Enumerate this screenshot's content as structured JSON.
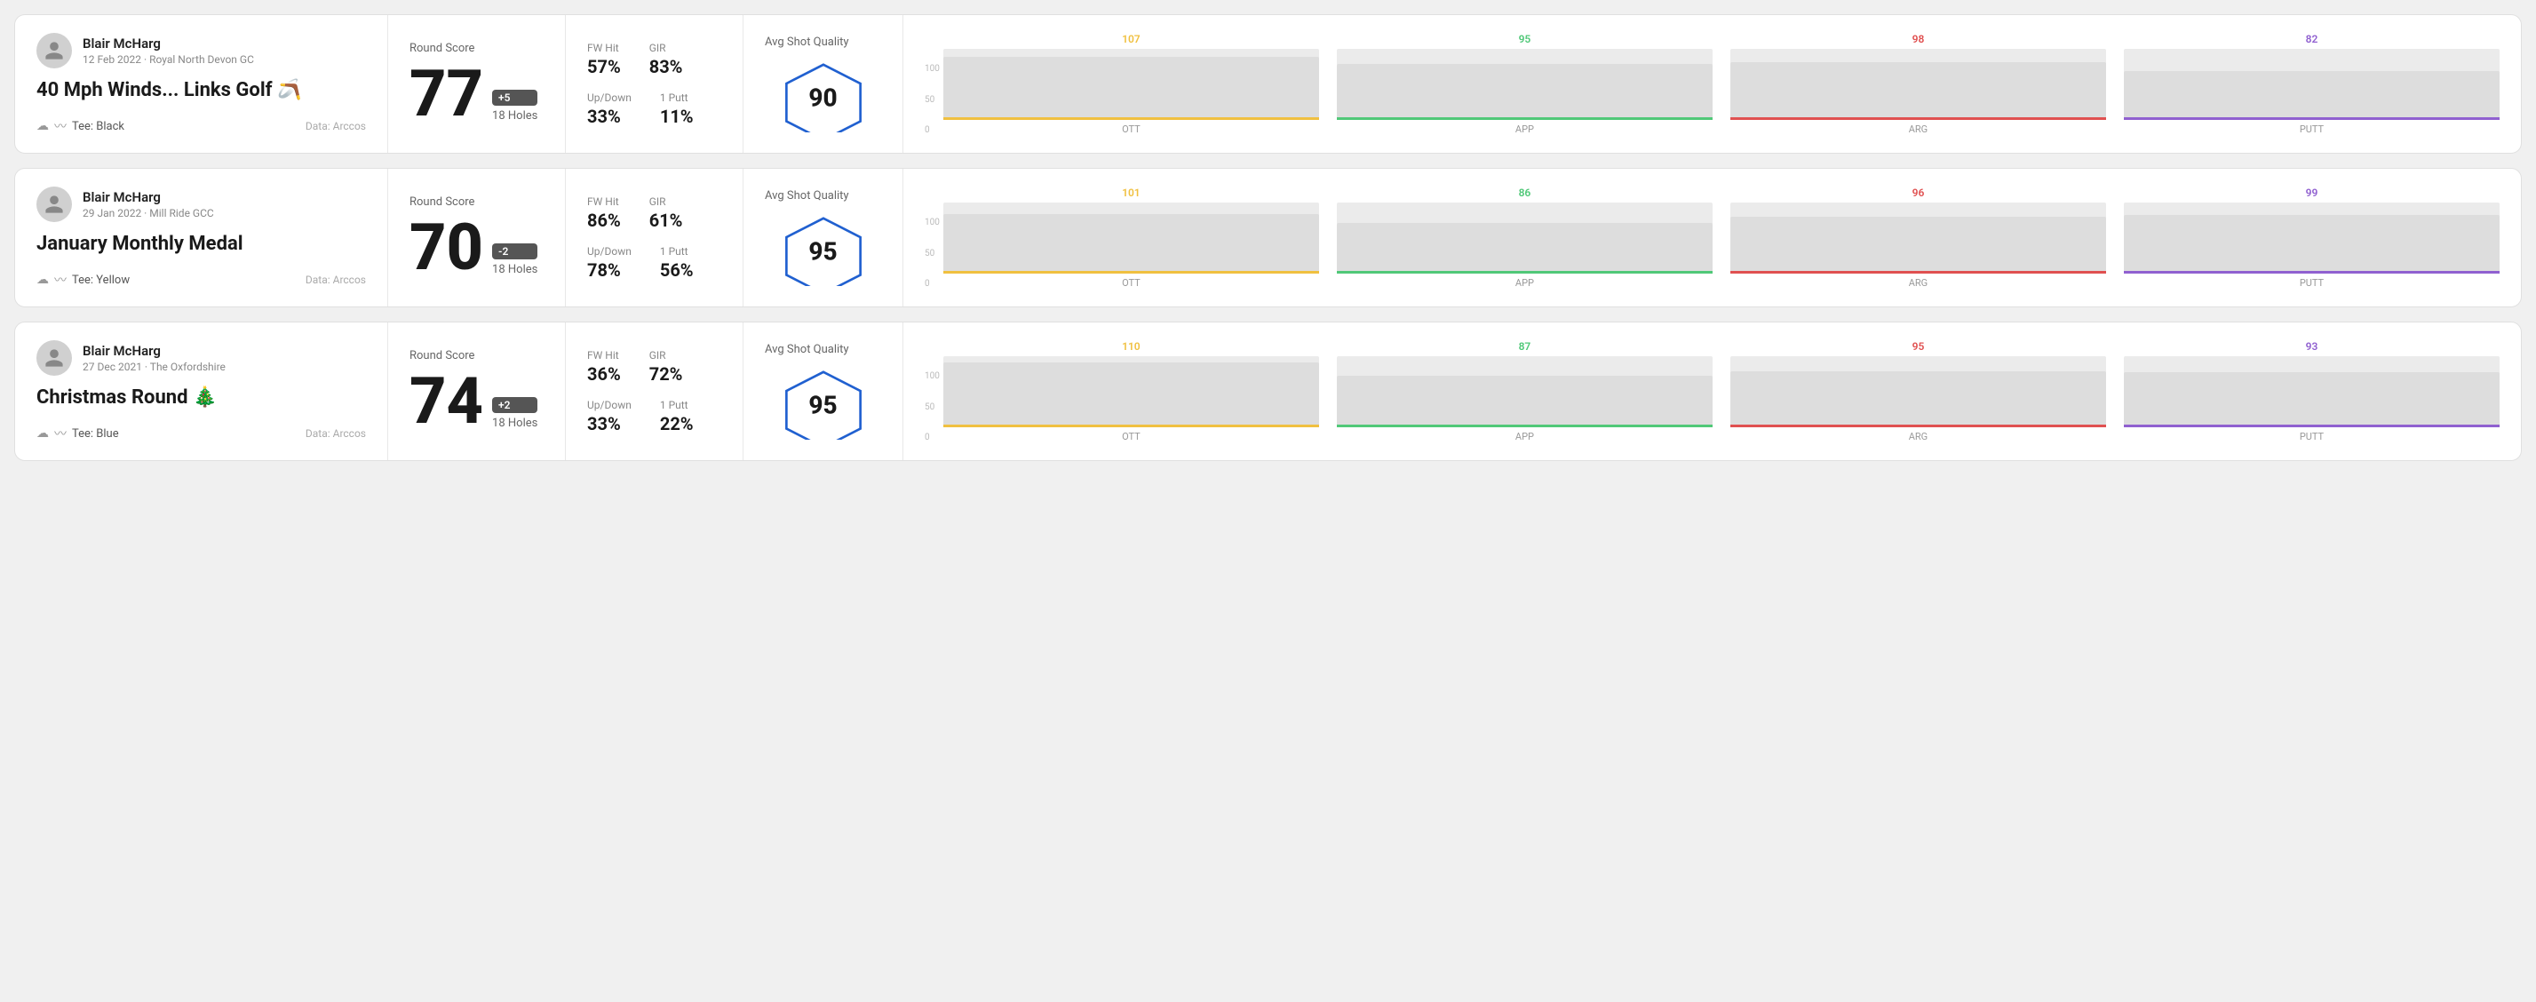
{
  "rounds": [
    {
      "id": "round-1",
      "user": {
        "name": "Blair McHarg",
        "date": "12 Feb 2022",
        "venue": "Royal North Devon GC"
      },
      "title": "40 Mph Winds... Links Golf 🪃",
      "tee": "Black",
      "data_source": "Data: Arccos",
      "score": {
        "label": "Round Score",
        "value": "77",
        "badge": "+5",
        "holes": "18 Holes"
      },
      "stats": {
        "fw_hit_label": "FW Hit",
        "fw_hit_value": "57%",
        "gir_label": "GIR",
        "gir_value": "83%",
        "updown_label": "Up/Down",
        "updown_value": "33%",
        "oneputt_label": "1 Putt",
        "oneputt_value": "11%"
      },
      "quality": {
        "label": "Avg Shot Quality",
        "score": "90"
      },
      "chart": {
        "bars": [
          {
            "label": "OTT",
            "value": 107,
            "color_class": "ott",
            "color": "#f0c040",
            "height_pct": 78
          },
          {
            "label": "APP",
            "value": 95,
            "color_class": "app",
            "color": "#50c878",
            "height_pct": 70
          },
          {
            "label": "ARG",
            "value": 98,
            "color_class": "arg",
            "color": "#e05050",
            "height_pct": 72
          },
          {
            "label": "PUTT",
            "value": 82,
            "color_class": "putt",
            "color": "#9060d0",
            "height_pct": 62
          }
        ],
        "y_labels": [
          "100",
          "50",
          "0"
        ]
      }
    },
    {
      "id": "round-2",
      "user": {
        "name": "Blair McHarg",
        "date": "29 Jan 2022",
        "venue": "Mill Ride GCC"
      },
      "title": "January Monthly Medal",
      "tee": "Yellow",
      "data_source": "Data: Arccos",
      "score": {
        "label": "Round Score",
        "value": "70",
        "badge": "-2",
        "holes": "18 Holes"
      },
      "stats": {
        "fw_hit_label": "FW Hit",
        "fw_hit_value": "86%",
        "gir_label": "GIR",
        "gir_value": "61%",
        "updown_label": "Up/Down",
        "updown_value": "78%",
        "oneputt_label": "1 Putt",
        "oneputt_value": "56%"
      },
      "quality": {
        "label": "Avg Shot Quality",
        "score": "95"
      },
      "chart": {
        "bars": [
          {
            "label": "OTT",
            "value": 101,
            "color_class": "ott",
            "color": "#f0c040",
            "height_pct": 75
          },
          {
            "label": "APP",
            "value": 86,
            "color_class": "app",
            "color": "#50c878",
            "height_pct": 64
          },
          {
            "label": "ARG",
            "value": 96,
            "color_class": "arg",
            "color": "#e05050",
            "height_pct": 71
          },
          {
            "label": "PUTT",
            "value": 99,
            "color_class": "putt",
            "color": "#9060d0",
            "height_pct": 73
          }
        ],
        "y_labels": [
          "100",
          "50",
          "0"
        ]
      }
    },
    {
      "id": "round-3",
      "user": {
        "name": "Blair McHarg",
        "date": "27 Dec 2021",
        "venue": "The Oxfordshire"
      },
      "title": "Christmas Round 🎄",
      "tee": "Blue",
      "data_source": "Data: Arccos",
      "score": {
        "label": "Round Score",
        "value": "74",
        "badge": "+2",
        "holes": "18 Holes"
      },
      "stats": {
        "fw_hit_label": "FW Hit",
        "fw_hit_value": "36%",
        "gir_label": "GIR",
        "gir_value": "72%",
        "updown_label": "Up/Down",
        "updown_value": "33%",
        "oneputt_label": "1 Putt",
        "oneputt_value": "22%"
      },
      "quality": {
        "label": "Avg Shot Quality",
        "score": "95"
      },
      "chart": {
        "bars": [
          {
            "label": "OTT",
            "value": 110,
            "color_class": "ott",
            "color": "#f0c040",
            "height_pct": 80
          },
          {
            "label": "APP",
            "value": 87,
            "color_class": "app",
            "color": "#50c878",
            "height_pct": 65
          },
          {
            "label": "ARG",
            "value": 95,
            "color_class": "arg",
            "color": "#e05050",
            "height_pct": 70
          },
          {
            "label": "PUTT",
            "value": 93,
            "color_class": "putt",
            "color": "#9060d0",
            "height_pct": 69
          }
        ],
        "y_labels": [
          "100",
          "50",
          "0"
        ]
      }
    }
  ],
  "labels": {
    "tee_prefix": "Tee:",
    "round_score": "Round Score",
    "avg_shot_quality": "Avg Shot Quality",
    "fw_hit": "FW Hit",
    "gir": "GIR",
    "updown": "Up/Down",
    "oneputt": "1 Putt"
  }
}
